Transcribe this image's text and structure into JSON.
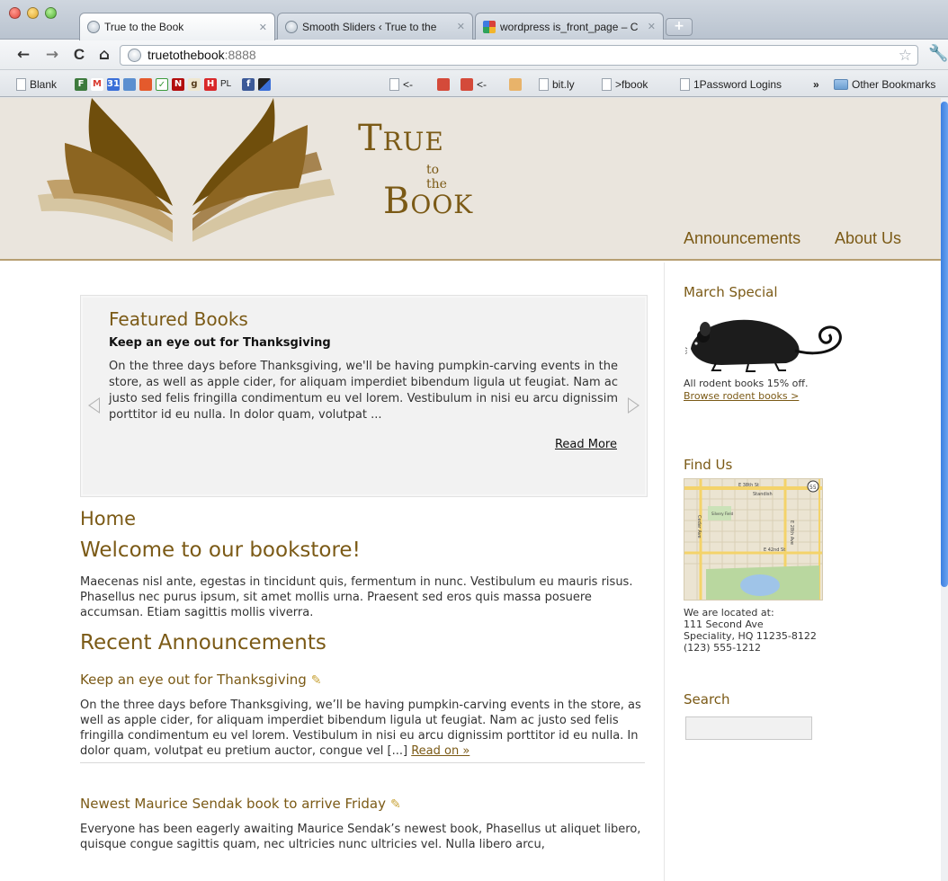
{
  "browser": {
    "tabs": [
      {
        "title": "True to the Book",
        "active": true
      },
      {
        "title": "Smooth Sliders ‹ True to the",
        "active": false
      },
      {
        "title": "wordpress is_front_page – C",
        "active": false
      }
    ],
    "url_host": "truetothebook",
    "url_port": ":8888",
    "bookmarks": [
      {
        "label": "Blank",
        "icon": "page-icon"
      },
      {
        "label": "<-",
        "icon": "page-icon"
      },
      {
        "label": "<-",
        "icon": "cube-icon"
      },
      {
        "label": "bit.ly",
        "icon": "page-icon"
      },
      {
        "label": ">fbook",
        "icon": "page-icon"
      },
      {
        "label": "1Password Logins",
        "icon": "page-icon"
      },
      {
        "label": "»",
        "icon": "chevron-icon"
      },
      {
        "label": "Other Bookmarks",
        "icon": "folder-icon"
      }
    ],
    "bookmark_favicon_letters": {
      "gmail": "M",
      "calendar": "31",
      "netflix": "N",
      "goodreads": "g",
      "h": "H",
      "pl": "PL",
      "facebook": "f"
    }
  },
  "site": {
    "brand": {
      "line1": "True",
      "line2": "to the",
      "line3": "Book"
    },
    "menu": [
      "Announcements",
      "About Us"
    ],
    "colors": {
      "accent": "#7b5a16",
      "header_bg": "#eae5dd",
      "logo_dark": "#6f4e0c",
      "logo_light": "#c8b48a"
    }
  },
  "slider": {
    "heading": "Featured Books",
    "item_title": "Keep an eye out for Thanksgiving",
    "item_text": "On the three days before Thanksgiving, we'll be having pumpkin-carving events in the store, as well as apple cider, for aliquam imperdiet bibendum ligula ut feugiat. Nam ac justo sed felis fringilla condimentum eu vel lorem. Vestibulum in nisi eu arcu dignissim porttitor id eu nulla. In dolor quam, volutpat ...",
    "read_more": "Read More"
  },
  "main": {
    "home": "Home",
    "welcome": "Welcome to our bookstore!",
    "intro": "Maecenas nisl ante, egestas in tincidunt quis, fermentum in nunc. Vestibulum eu mauris risus. Phasellus nec purus ipsum, sit amet mollis urna. Praesent sed eros quis massa posuere accumsan. Etiam sagittis mollis viverra.",
    "recent_heading": "Recent Announcements",
    "posts": [
      {
        "title": "Keep an eye out for Thanksgiving",
        "body": "On the three days before Thanksgiving, we’ll be having pumpkin-carving events in the store, as well as apple cider, for aliquam imperdiet bibendum ligula ut feugiat. Nam ac justo sed felis fringilla condimentum eu vel lorem. Vestibulum in nisi eu arcu dignissim porttitor id eu nulla. In dolor quam, volutpat eu pretium auctor, congue vel [...]",
        "read_on": "Read on »"
      },
      {
        "title": "Newest Maurice Sendak book to arrive Friday",
        "body": "Everyone has been eagerly awaiting Maurice Sendak’s newest book, Phasellus ut aliquet libero, quisque congue sagittis quam, nec ultricies nunc ultricies vel. Nulla libero arcu,"
      }
    ]
  },
  "sidebar": {
    "special_heading": "March Special",
    "special_text": "All rodent books 15% off.",
    "special_link": "Browse rodent books >",
    "find_heading": "Find Us",
    "address_lines": [
      "We are located at:",
      "111 Second Ave",
      "Speciality, HQ 11235-8122",
      "(123) 555-1212"
    ],
    "map_labels": {
      "st1": "E 38th St",
      "standish": "Standish",
      "park": "Silvery Field",
      "st2": "E 42nd St",
      "ave1": "Cedar Ave",
      "ave2": "E 28th Ave",
      "route": "55"
    },
    "search_heading": "Search"
  }
}
